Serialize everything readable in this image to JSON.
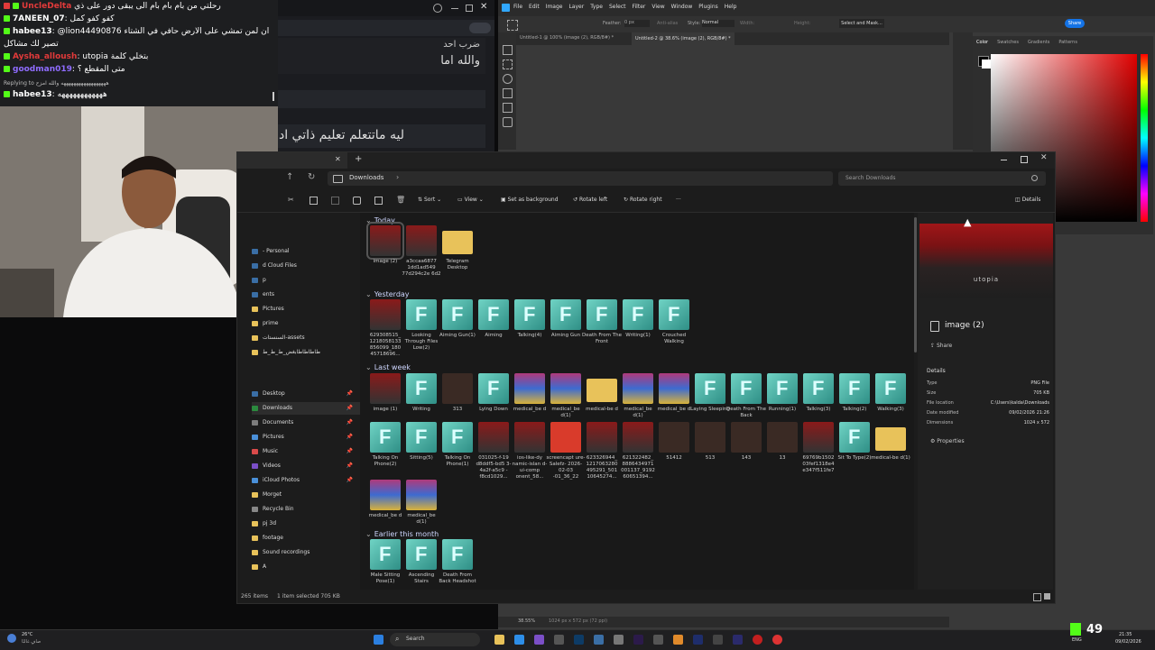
{
  "chat": {
    "lines": [
      {
        "user": "UncleDelta",
        "sep": "",
        "msg": "رحلتي من بام بام بام الى يبقى دور على ذي",
        "color": "#e23a3a"
      },
      {
        "user": "7ANEEN_07",
        "sep": ":",
        "msg": "كفو كفو كمل",
        "color": "#ffffff"
      },
      {
        "user": "habee13",
        "sep": ":",
        "msg": "@lion44490876 ان لمن تمشي على الارض حافي في الشتاء",
        "color": "#ffffff"
      },
      {
        "user": "",
        "sep": "",
        "msg": "تصير لك مشاكل",
        "color": "#ffffff"
      },
      {
        "user": "Aysha_alloush",
        "sep": ":",
        "msg": "utopia بتخلي كلمة",
        "color": "#e23a3a"
      },
      {
        "user": "goodman019",
        "sep": ":",
        "msg": "متى المقطع ؟",
        "color": "#8f6cff"
      },
      {
        "user": "Replying to",
        "sep": "",
        "msg": "ههههههههههههههههههه والله امزح",
        "color": "#bdbdbd"
      },
      {
        "user": "habee13",
        "sep": ":",
        "msg": "ههههههههههههه",
        "color": "#ffffff"
      }
    ]
  },
  "browser": {
    "lines": [
      "ضرب احد",
      "والله اما",
      "ليه ماتتعلم تعليم ذاتي اد"
    ]
  },
  "photoshop": {
    "menu": [
      "File",
      "Edit",
      "Image",
      "Layer",
      "Type",
      "Select",
      "Filter",
      "View",
      "Window",
      "Plugins",
      "Help"
    ],
    "options": [
      "Feather:",
      "0 px",
      "Anti-alias",
      "Style:",
      "Normal",
      "Width:",
      "Height:",
      "Select and Mask..."
    ],
    "share_label": "Share",
    "tab1": "Untitled-1 @ 100% (image (2), RGB/8#) *",
    "tab2": "Untitled-2 @ 38.6% (image (2), RGB/8#) *",
    "panel_tabs": [
      "Color",
      "Swatches",
      "Gradients",
      "Patterns"
    ],
    "zoom": "38.55%",
    "doc_info": "1024 px x 572 px (72 ppi)"
  },
  "explorer": {
    "address": "Downloads",
    "search_placeholder": "Search Downloads",
    "toolbar": [
      "Sort",
      "View",
      "Set as background",
      "Rotate left",
      "Rotate right",
      "···",
      "Details"
    ],
    "nav_top": [
      "- Personal",
      "d Cloud Files",
      "p",
      "ents",
      "Pictures",
      "prime",
      "السنستات-assets",
      "طاطاطاطابغض_ط_ط_ط"
    ],
    "nav_pinned": [
      "Desktop",
      "Downloads",
      "Documents",
      "Pictures",
      "Music",
      "Videos",
      "iCloud Photos",
      "Morget",
      "Recycle Bin",
      "pj 3d",
      "footage",
      "Sound recordings",
      "A"
    ],
    "sections": {
      "today": "Today",
      "yesterday": "Yesterday",
      "last_week": "Last week",
      "earlier": "Earlier this month"
    },
    "today_items": [
      "image (2)",
      "a3ccaa6877 1dd1ad549 77d294c2e 6d2",
      "Telegram Desktop"
    ],
    "yesterday_items": [
      "629308515_ 1218058133 856099_180 45718696...",
      "Looking Through Files Low(2)",
      "Aiming Gun(1)",
      "Aiming",
      "Talking(4)",
      "Aiming Gun",
      "Death From The Front",
      "Writing(1)",
      "Crouched Walking"
    ],
    "lastweek_row1": [
      "image (1)",
      "Writing",
      "313",
      "Lying Down",
      "medical_be d",
      "medical_be d(1)",
      "medical-be d",
      "medical_be d(1)",
      "medical_be d",
      "Laying Sleeping",
      "Death From The Back",
      "Running(1)",
      "Talking(3)",
      "Talking(2)",
      "Walking(3)"
    ],
    "lastweek_row2": [
      "Talking On Phone(2)",
      "Sitting(5)",
      "Talking On Phone(1)",
      "031025-f-19 d8ddf5-bd5 3-4a2f-a5c9 -f8cd1029...",
      "ios-like-dy namic-islan d-ui-comp onent_58...",
      "screencapt ure-Salefz- 2026-02-03 -01_36_22",
      "623326944_ 1217063280 495291_501 10645274...",
      "621322482_ 8886434971 001137_9192 60651394...",
      "51412",
      "513",
      "143",
      "13",
      "69769b1502 03fef1318e4 e347f511fe7",
      "Sit To Type(2)",
      "medical-be d(1)"
    ],
    "lastweek_row3": [
      "medical_be d",
      "medical_be d(1)"
    ],
    "earlier_items": [
      "Male Sitting Pose(1)",
      "Ascending Stairs",
      "Death From Back Headshot"
    ],
    "status_count": "265 items",
    "status_selected": "1 item selected  705 KB",
    "details": {
      "filename": "image (2)",
      "share": "Share",
      "heading": "Details",
      "rows": [
        {
          "k": "Type",
          "v": "PNG File"
        },
        {
          "k": "Size",
          "v": "705 KB"
        },
        {
          "k": "File location",
          "v": "C:\\Users\\kalda\\Downloads"
        },
        {
          "k": "Date modified",
          "v": "09/02/2026 21:26"
        },
        {
          "k": "Dimensions",
          "v": "1024 x 572"
        }
      ],
      "properties": "Properties",
      "preview_text": "utopia"
    }
  },
  "taskbar": {
    "weather_temp": "26°C",
    "weather_desc": "صافٍ غالبًا",
    "search_placeholder": "Search",
    "lang": "ENG",
    "time": "21:35",
    "date": "09/02/2026",
    "overlay_count": "49"
  },
  "colors": {
    "accent": "#0067c0",
    "kick_green": "#53fc18",
    "folder": "#e8c25a",
    "mixamo": "#46b6a8"
  }
}
